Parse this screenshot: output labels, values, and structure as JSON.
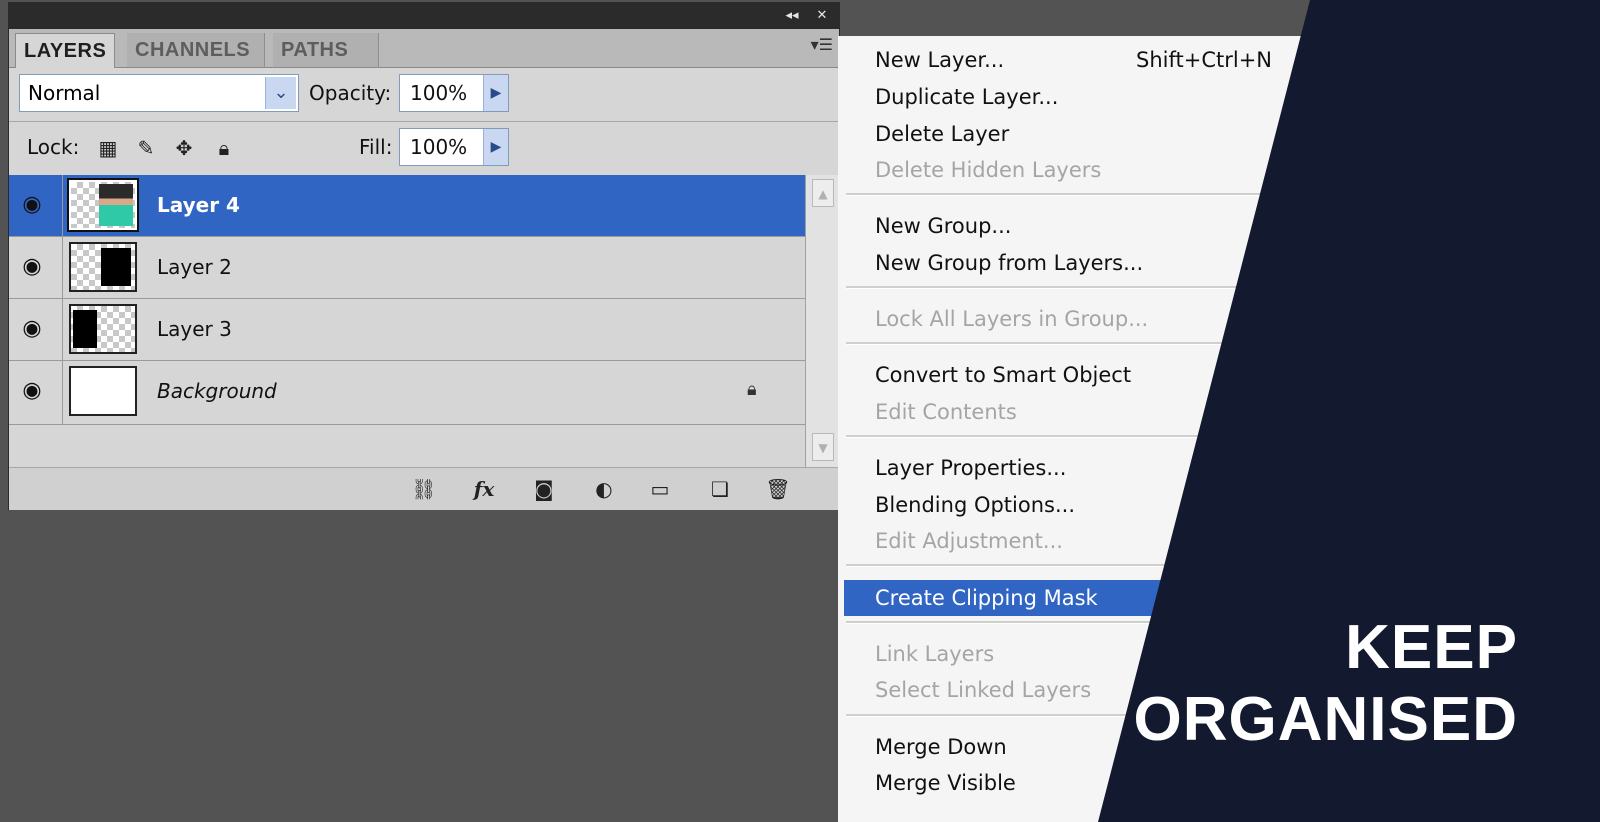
{
  "panel": {
    "titlebar_buttons": [
      "◂◂",
      "✕"
    ],
    "tabs": [
      {
        "label": "LAYERS",
        "active": true
      },
      {
        "label": "CHANNELS",
        "active": false
      },
      {
        "label": "PATHS",
        "active": false
      }
    ],
    "blend_mode": "Normal",
    "opacity_label": "Opacity:",
    "opacity_value": "100%",
    "lock_label": "Lock:",
    "fill_label": "Fill:",
    "fill_value": "100%"
  },
  "layers": [
    {
      "name": "Layer 4",
      "selected": true,
      "thumb": "photo"
    },
    {
      "name": "Layer 2",
      "selected": false,
      "thumb": "black-right"
    },
    {
      "name": "Layer 3",
      "selected": false,
      "thumb": "black-left"
    },
    {
      "name": "Background",
      "selected": false,
      "thumb": "white",
      "locked": true
    }
  ],
  "menu": {
    "items": [
      {
        "label": "New Layer...",
        "shortcut": "Shift+Ctrl+N",
        "disabled": false
      },
      {
        "label": "Duplicate Layer...",
        "disabled": false
      },
      {
        "label": "Delete Layer",
        "disabled": false
      },
      {
        "label": "Delete Hidden Layers",
        "disabled": true
      },
      {
        "label": "New Group...",
        "disabled": false
      },
      {
        "label": "New Group from Layers...",
        "disabled": false
      },
      {
        "label": "Lock All Layers in Group...",
        "disabled": true
      },
      {
        "label": "Convert to Smart Object",
        "disabled": false
      },
      {
        "label": "Edit Contents",
        "disabled": true
      },
      {
        "label": "Layer Properties...",
        "disabled": false
      },
      {
        "label": "Blending Options...",
        "disabled": false
      },
      {
        "label": "Edit Adjustment...",
        "disabled": true
      },
      {
        "label": "Create Clipping Mask",
        "disabled": false,
        "highlighted": true
      },
      {
        "label": "Link Layers",
        "disabled": true
      },
      {
        "label": "Select Linked Layers",
        "disabled": true
      },
      {
        "label": "Merge Down",
        "disabled": false
      },
      {
        "label": "Merge Visible",
        "disabled": false
      }
    ]
  },
  "headline": {
    "line1": "KEEP",
    "line2": "ORGANISED"
  },
  "colors": {
    "accent": "#3165c4",
    "navy": "#131a30",
    "workspace": "#535353"
  }
}
